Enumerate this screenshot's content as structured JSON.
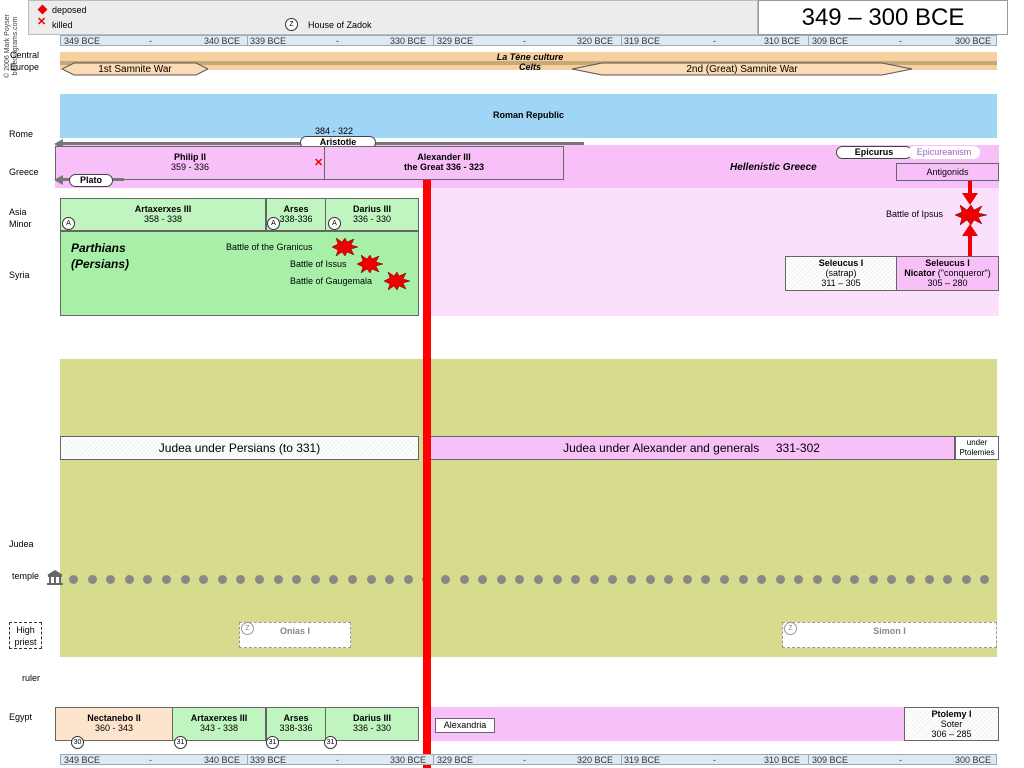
{
  "legend": {
    "deposed": "deposed",
    "killed": "killed",
    "zadok_symbol": "Z",
    "house_of_zadok": "House of Zadok"
  },
  "copyright": "© 2006 Mark Poyser biblediagrams.com",
  "title": "349 – 300 BCE",
  "scale": {
    "labels": [
      "349 BCE",
      "-",
      "340 BCE",
      "339 BCE",
      "-",
      "330 BCE",
      "329 BCE",
      "-",
      "320 BCE",
      "319 BCE",
      "-",
      "310 BCE",
      "309 BCE",
      "-",
      "300 BCE"
    ]
  },
  "rows": {
    "central_europe": "Central Europe",
    "rome": "Rome",
    "greece": "Greece",
    "asia_minor": "Asia Minor",
    "syria": "Syria",
    "judea": "Judea",
    "temple": "temple",
    "high_priest": "High priest",
    "ruler": "ruler",
    "egypt": "Egypt"
  },
  "europe": {
    "war1": "1st Samnite War",
    "la_tene": "La Tène culture",
    "celts": "Celts",
    "war2": "2nd (Great) Samnite War"
  },
  "rome": {
    "republic": "Roman Republic"
  },
  "greece": {
    "aristotle_dates": "384 - 322",
    "aristotle": "Aristotle",
    "philip_name": "Philip II",
    "philip_dates": "359 - 336",
    "alexander_name": "Alexander III",
    "alexander_line2": "the Great   336 - 323",
    "plato": "Plato",
    "epicurus": "Epicurus",
    "epicureanism": "Epicureanism",
    "hellenistic": "Hellenistic Greece",
    "antigonids": "Antigonids"
  },
  "asia": {
    "artaxerxes_name": "Artaxerxes III",
    "artaxerxes_dates": "358 - 338",
    "arses_name": "Arses",
    "arses_dates": "338-336",
    "darius_name": "Darius III",
    "darius_dates": "336 - 330",
    "a_symbol": "A",
    "parthians_line1": "Parthians",
    "parthians_line2": "(Persians)",
    "granicus": "Battle of the Granicus",
    "issus": "Battle of Issus",
    "gaugemala": "Battle of Gaugemala",
    "ipsus": "Battle of Ipsus",
    "seleucus_satrap_name": "Seleucus I",
    "seleucus_satrap_role": "(satrap)",
    "seleucus_satrap_dates": "311 – 305",
    "seleucus_nicator_name": "Seleucus I",
    "seleucus_nicator_title": "Nicator",
    "seleucus_nicator_meaning": "(\"conqueror\")",
    "seleucus_nicator_dates": "305 – 280"
  },
  "judea": {
    "persians": "Judea under Persians (to 331)",
    "alexander": "Judea under Alexander and generals     331-302",
    "ptolemies_line1": "under",
    "ptolemies_line2": "Ptolemies",
    "onias": "Onias I",
    "simon": "Simon I",
    "zadok_symbol": "Z"
  },
  "egypt": {
    "nectanebo_name": "Nectanebo II",
    "nectanebo_dates": "360 - 343",
    "artaxerxes_name": "Artaxerxes III",
    "artaxerxes_dates": "343 - 338",
    "arses_name": "Arses",
    "arses_dates": "338-336",
    "darius_name": "Darius III",
    "darius_dates": "336 - 330",
    "dyn30": "30",
    "dyn31": "31",
    "alexandria": "Alexandria",
    "ptolemy_name": "Ptolemy I",
    "ptolemy_title": "Soter",
    "ptolemy_dates": "306 – 285"
  },
  "colors": {
    "persia_green": "#a8f0a8",
    "greek_pink": "#f8c0f8",
    "judea_olive": "#d6db8e",
    "rome_blue": "#9fd5f5",
    "alexander_line": "#ff0000",
    "europe_tan": "#f5d0a0"
  }
}
